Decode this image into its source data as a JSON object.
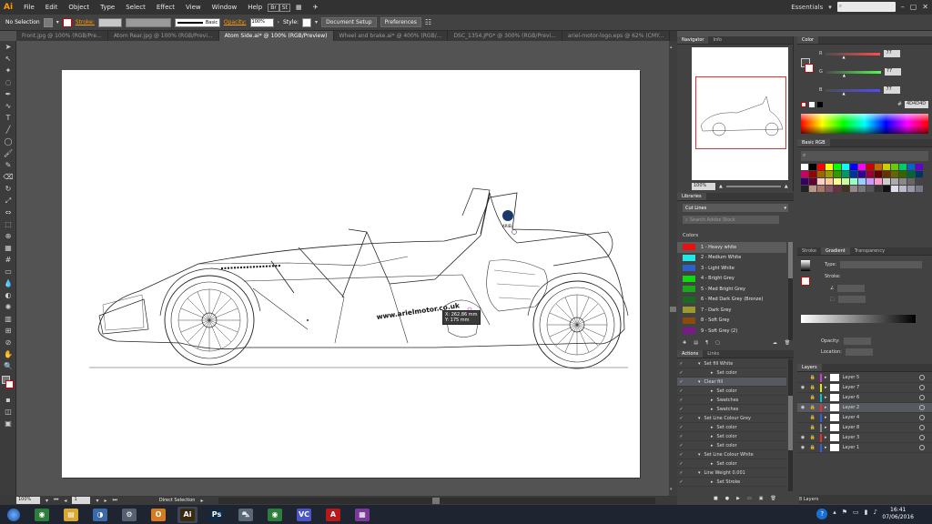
{
  "app": {
    "logo": "Ai"
  },
  "menu": [
    "File",
    "Edit",
    "Object",
    "Type",
    "Select",
    "Effect",
    "View",
    "Window",
    "Help"
  ],
  "menubar_right": {
    "workspace": "Essentials",
    "search_placeholder": ""
  },
  "control_bar": {
    "selection": "No Selection",
    "stroke_label": "Stroke:",
    "brush": "Basic",
    "opacity_label": "Opacity:",
    "opacity_value": "100%",
    "style_label": "Style:",
    "doc_setup": "Document Setup",
    "preferences": "Preferences"
  },
  "tabs": [
    {
      "label": "Front.jpg @ 100% (RGB/Pre...",
      "active": false
    },
    {
      "label": "Atom Rear.jpg @ 100% (RGB/Previ...",
      "active": false
    },
    {
      "label": "Atom Side.ai* @ 100% (RGB/Preview)",
      "active": true
    },
    {
      "label": "Wheel and brake.ai* @ 400% (RGB/...",
      "active": false
    },
    {
      "label": "DSC_1354.JPG* @ 300% (RGB/Previ...",
      "active": false
    },
    {
      "label": "ariel-motor-logo.eps @ 62% (CMY...",
      "active": false
    }
  ],
  "canvas": {
    "watermark_text": "www.arielmotor.co.uk",
    "logo_text": "ARIEL",
    "tooltip_x": "X: 262.86 mm",
    "tooltip_y": "Y: 175 mm"
  },
  "status": {
    "zoom": "100%",
    "artboard": "1",
    "tool": "Direct Selection"
  },
  "navigator": {
    "tabs": [
      "Navigator",
      "Info"
    ],
    "zoom": "100%"
  },
  "color_panel": {
    "tab": "Color",
    "r_label": "R",
    "g_label": "G",
    "b_label": "B",
    "r": "77",
    "g": "77",
    "b": "77",
    "r_pos": 0.3,
    "g_pos": 0.3,
    "b_pos": 0.3,
    "hex": "4D4D4D",
    "swatch_tab": "Basic RGB"
  },
  "libraries": {
    "tab": "Libraries",
    "library": "Cut Lines",
    "search_placeholder": "Search Adobe Stock",
    "colors_label": "Colors",
    "colors": [
      {
        "name": "1 - Heavy white",
        "color": "#e81010",
        "selected": true
      },
      {
        "name": "2 - Medium White",
        "color": "#20e8e8",
        "selected": false
      },
      {
        "name": "3 - Light White",
        "color": "#2c62c8",
        "selected": false
      },
      {
        "name": "4 - Bright Grey",
        "color": "#10d810",
        "selected": false
      },
      {
        "name": "5 - Med Bright Grey",
        "color": "#18a818",
        "selected": false
      },
      {
        "name": "6 - Med Dark Grey (Bronze)",
        "color": "#1a6a22",
        "selected": false
      },
      {
        "name": "7 - Dark Grey",
        "color": "#9a9a30",
        "selected": false
      },
      {
        "name": "8 - Soft Grey",
        "color": "#8a4a10",
        "selected": false
      },
      {
        "name": "9 - Soft Grey (2)",
        "color": "#7a1a8a",
        "selected": false
      }
    ]
  },
  "gradient_panel": {
    "tabs": [
      "Stroke",
      "Gradient",
      "Transparency"
    ],
    "type_label": "Type:",
    "stroke_label": "Stroke:",
    "opacity_label": "Opacity:",
    "location_label": "Location:"
  },
  "actions": {
    "tabs": [
      "Actions",
      "Links"
    ],
    "rows": [
      {
        "indent": 1,
        "label": "Set fill White",
        "open": true
      },
      {
        "indent": 2,
        "label": "Set color",
        "open": false
      },
      {
        "indent": 1,
        "label": "Clear fill",
        "open": true,
        "selected": true
      },
      {
        "indent": 2,
        "label": "Set color",
        "open": false
      },
      {
        "indent": 2,
        "label": "Swatches",
        "open": false
      },
      {
        "indent": 2,
        "label": "Swatches",
        "open": false
      },
      {
        "indent": 1,
        "label": "Set Line Colour Grey",
        "open": true
      },
      {
        "indent": 2,
        "label": "Set color",
        "open": false
      },
      {
        "indent": 2,
        "label": "Set color",
        "open": false
      },
      {
        "indent": 2,
        "label": "Set color",
        "open": false
      },
      {
        "indent": 1,
        "label": "Set Line Colour White",
        "open": true
      },
      {
        "indent": 2,
        "label": "Set color",
        "open": false
      },
      {
        "indent": 1,
        "label": "Line Weight 0.001",
        "open": true
      },
      {
        "indent": 2,
        "label": "Set Stroke",
        "open": false
      }
    ]
  },
  "layers": {
    "tab": "Layers",
    "count": "8 Layers",
    "rows": [
      {
        "name": "Layer 5",
        "color": "#d838d8",
        "selected": false,
        "eye": false
      },
      {
        "name": "Layer 7",
        "color": "#e8e800",
        "selected": false,
        "eye": true
      },
      {
        "name": "Layer 6",
        "color": "#00c8c8",
        "selected": false,
        "eye": false
      },
      {
        "name": "Layer 2",
        "color": "#e83030",
        "selected": true,
        "eye": true
      },
      {
        "name": "Layer 4",
        "color": "#3060e8",
        "selected": false,
        "eye": false
      },
      {
        "name": "Layer 8",
        "color": "#8a8a8a",
        "selected": false,
        "eye": false
      },
      {
        "name": "Layer 3",
        "color": "#e83030",
        "selected": false,
        "eye": true
      },
      {
        "name": "Layer 1",
        "color": "#3060e8",
        "selected": false,
        "eye": true
      }
    ]
  },
  "taskbar": {
    "apps": [
      {
        "name": "chrome",
        "glyph": "◉",
        "bg": "#2f7d3b"
      },
      {
        "name": "explorer",
        "glyph": "▤",
        "bg": "#d8a930"
      },
      {
        "name": "app-3",
        "glyph": "◑",
        "bg": "#3a6aa8"
      },
      {
        "name": "app-4",
        "glyph": "⚙",
        "bg": "#556070"
      },
      {
        "name": "outlook",
        "glyph": "O",
        "bg": "#d87a20"
      },
      {
        "name": "illustrator",
        "glyph": "Ai",
        "bg": "#3a2a10",
        "active": true
      },
      {
        "name": "photoshop",
        "glyph": "Ps",
        "bg": "#0f2a44"
      },
      {
        "name": "car-app",
        "glyph": "⛍",
        "bg": "#5a6878"
      },
      {
        "name": "chrome-2",
        "glyph": "◉",
        "bg": "#2f7d3b"
      },
      {
        "name": "app-10",
        "glyph": "VC",
        "bg": "#4a56c8"
      },
      {
        "name": "acrobat",
        "glyph": "A",
        "bg": "#b81818"
      },
      {
        "name": "winrar",
        "glyph": "▦",
        "bg": "#7a3a9a"
      }
    ],
    "time": "16:41",
    "date": "07/06/2016"
  },
  "colors": {
    "accent": "#ff9a00",
    "panel": "#424242",
    "canvas": "#535353"
  }
}
